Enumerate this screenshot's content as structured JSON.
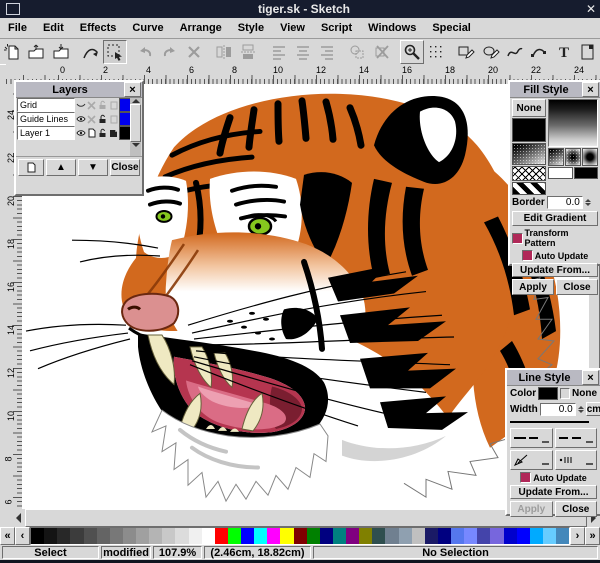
{
  "window": {
    "title": "tiger.sk - Sketch",
    "close_icon": "✕"
  },
  "menubar": {
    "items": [
      "File",
      "Edit",
      "Effects",
      "Curve",
      "Arrange",
      "Style",
      "View",
      "Script",
      "Windows",
      "Special"
    ]
  },
  "toolbar": {
    "buttons": [
      {
        "icon": "new-document",
        "enabled": true
      },
      {
        "icon": "open-document",
        "enabled": true
      },
      {
        "icon": "save-document",
        "enabled": true
      },
      {
        "sep": true
      },
      {
        "icon": "edit-mode",
        "enabled": true
      },
      {
        "icon": "selection-mode",
        "enabled": true,
        "pressed": true
      },
      {
        "sep": true
      },
      {
        "icon": "undo",
        "enabled": false
      },
      {
        "icon": "redo",
        "enabled": false
      },
      {
        "icon": "delete",
        "enabled": false
      },
      {
        "sep": true
      },
      {
        "icon": "flip-horizontal",
        "enabled": false
      },
      {
        "icon": "flip-vertical",
        "enabled": false
      },
      {
        "sep": true
      },
      {
        "icon": "align-left",
        "enabled": false
      },
      {
        "icon": "align-center",
        "enabled": false
      },
      {
        "icon": "align-right",
        "enabled": false
      },
      {
        "sep": true
      },
      {
        "icon": "snap-to-objects",
        "enabled": false
      },
      {
        "icon": "snap-off",
        "enabled": false
      },
      {
        "sep": true
      },
      {
        "icon": "zoom-tool",
        "enabled": true,
        "framed": true
      },
      {
        "icon": "grid-toggle",
        "enabled": true
      },
      {
        "sep": true
      },
      {
        "icon": "rectangle-tool",
        "enabled": true
      },
      {
        "icon": "ellipse-tool",
        "enabled": true
      },
      {
        "icon": "freehand-tool",
        "enabled": true
      },
      {
        "icon": "bezier-tool",
        "enabled": true
      },
      {
        "icon": "text-tool",
        "enabled": true
      },
      {
        "icon": "image-tool",
        "enabled": true
      }
    ]
  },
  "rulers": {
    "horizontal": [
      0,
      2,
      4,
      6,
      8,
      10,
      12,
      14,
      16,
      18,
      20,
      22,
      24
    ],
    "vertical": [
      24,
      22,
      20,
      18,
      16,
      14,
      12,
      10,
      8,
      6
    ]
  },
  "layers_panel": {
    "title": "Layers",
    "close_icon": "×",
    "rows": [
      {
        "name": "Grid",
        "color": "#0000ee",
        "visible": false,
        "locked": false
      },
      {
        "name": "Guide Lines",
        "color": "#0000ee",
        "visible": true,
        "locked": false
      },
      {
        "name": "Layer 1",
        "color": "#000000",
        "visible": true,
        "locked": false
      }
    ],
    "buttons": {
      "up": "▲",
      "down": "▼",
      "close": "Close"
    }
  },
  "fill_style_panel": {
    "title": "Fill Style",
    "close_icon": "×",
    "none_label": "None",
    "border_label": "Border",
    "border_value": "0.0",
    "edit_gradient_label": "Edit Gradient",
    "transform_pattern_label": "Transform Pattern",
    "auto_update_label": "Auto Update",
    "update_from_label": "Update From...",
    "apply_label": "Apply",
    "close_label": "Close"
  },
  "line_style_panel": {
    "title": "Line Style",
    "close_icon": "×",
    "color_label": "Color",
    "none_label": "None",
    "width_label": "Width",
    "width_value": "0.0",
    "unit_label": "cm",
    "auto_update_label": "Auto Update",
    "update_from_label": "Update From...",
    "apply_label": "Apply",
    "close_label": "Close"
  },
  "colorbar": {
    "left_arrows": [
      "«",
      "‹"
    ],
    "right_arrows": [
      "›",
      "»"
    ],
    "colors": [
      "#000000",
      "#141414",
      "#282828",
      "#3c3c3c",
      "#505050",
      "#646464",
      "#787878",
      "#8c8c8c",
      "#a0a0a0",
      "#b4b4b4",
      "#c8c8c8",
      "#dcdcdc",
      "#f0f0f0",
      "#ffffff",
      "#ff0000",
      "#00ff00",
      "#0000ff",
      "#00ffff",
      "#ff00ff",
      "#ffff00",
      "#800000",
      "#008000",
      "#000080",
      "#008080",
      "#800080",
      "#808000",
      "#2f4f4f",
      "#708090",
      "#8fa0b0",
      "#c0c0c0",
      "#1a1a66",
      "#000080",
      "#5577ee",
      "#7788ff",
      "#4444aa",
      "#7766dd",
      "#0000cc",
      "#0000ff",
      "#00aaff",
      "#66ccff",
      "#4488bb"
    ]
  },
  "statusbar": {
    "mode": "Select",
    "doc_state": "modified",
    "zoom": "107.9%",
    "position": "(2.46cm, 18.82cm)",
    "selection": "No Selection"
  },
  "artwork": {
    "description": "roaring tiger head drawing",
    "colors": {
      "orange": "#d2691e",
      "dark_orange": "#8a3a08",
      "eye_green": "#86c81e",
      "mouth_red": "#b5354f",
      "throat_dark": "#7a1e30",
      "tongue_pink": "#da6c85",
      "tongue_light": "#eda0b2",
      "nose_pink": "#db9090",
      "fang_cream": "#efe9c2"
    }
  }
}
